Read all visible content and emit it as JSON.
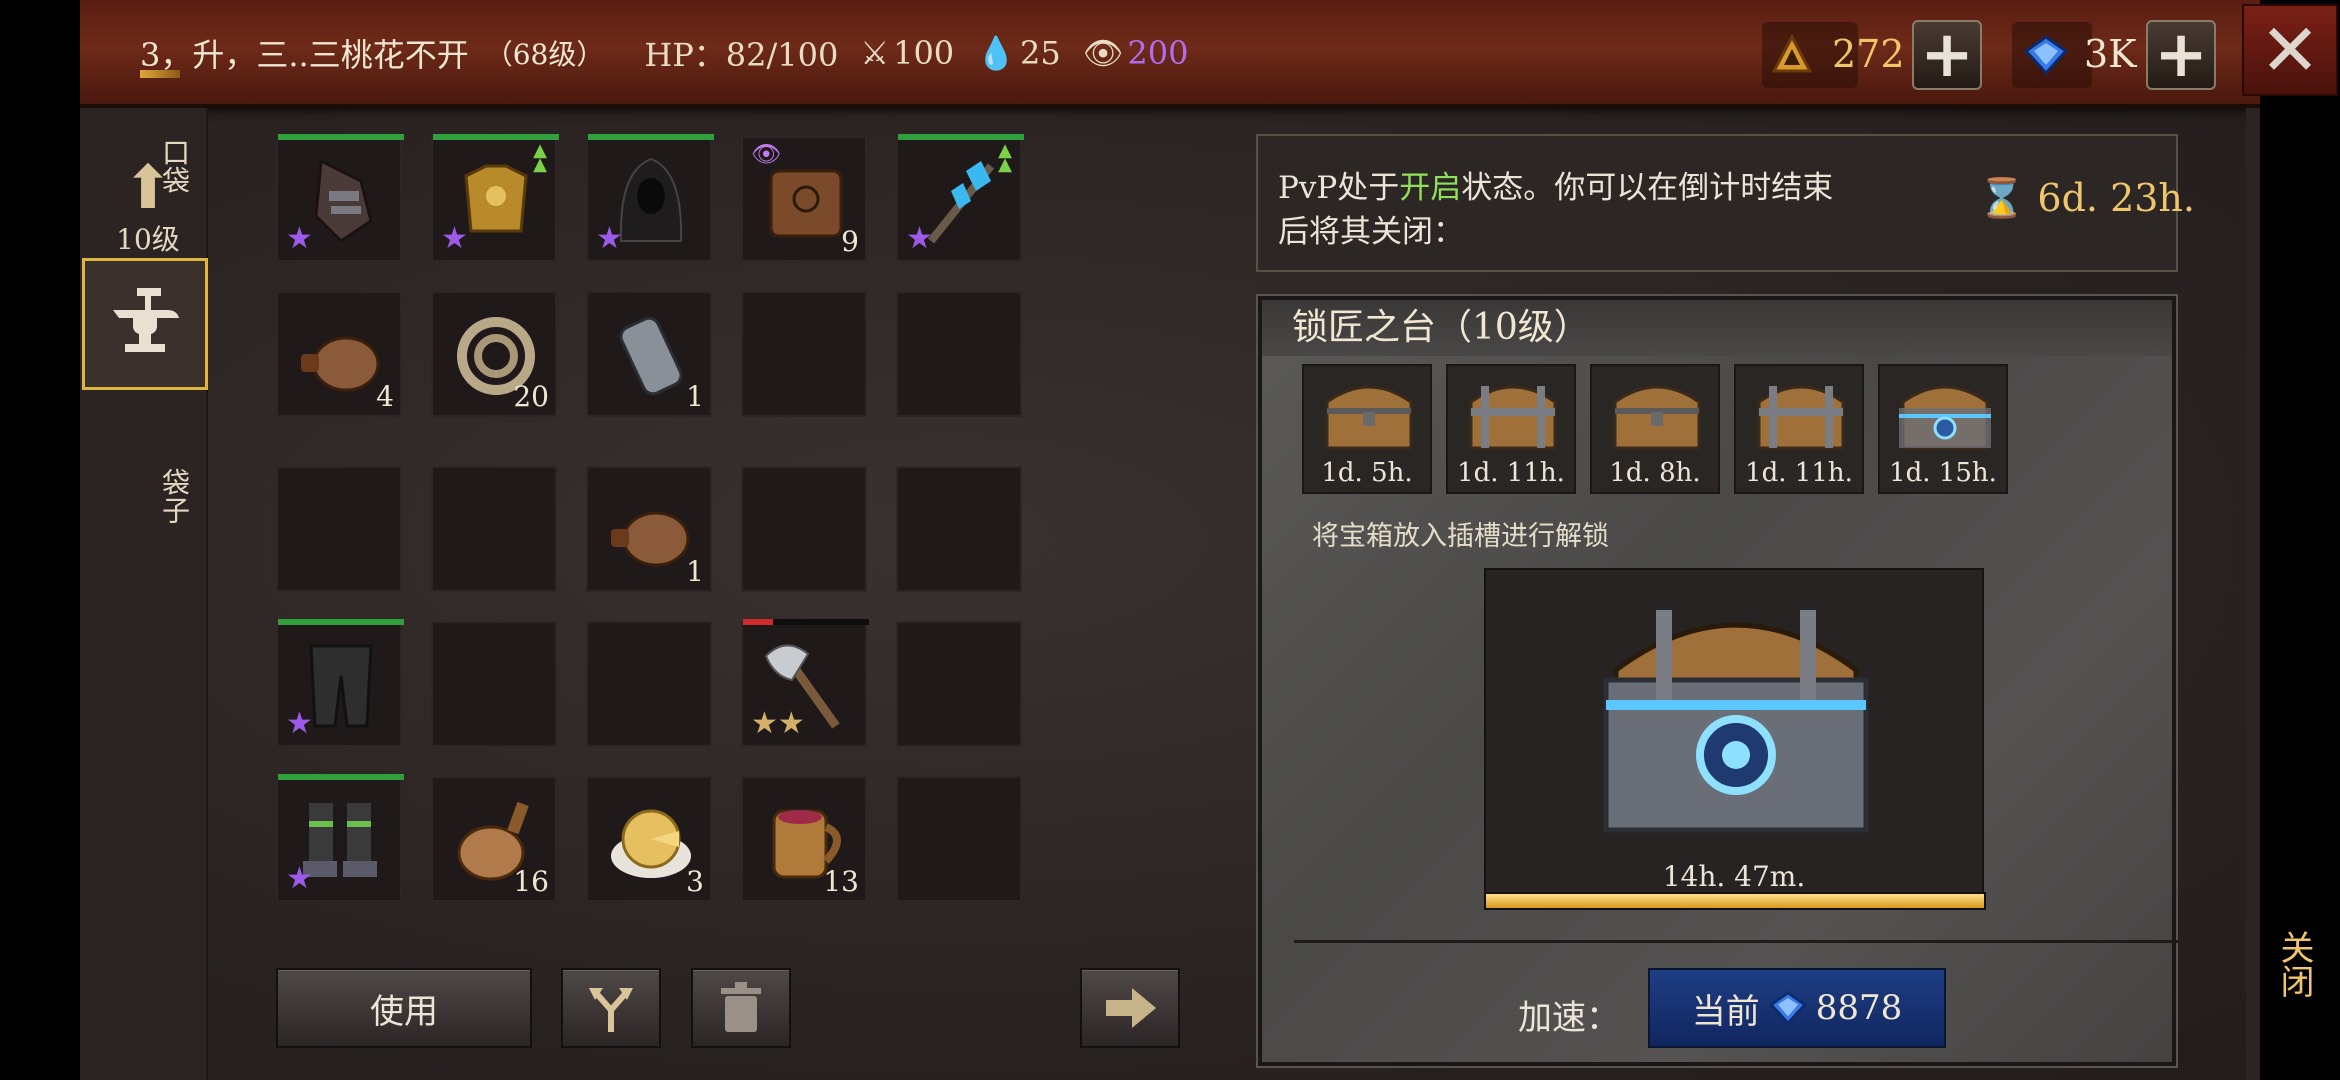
{
  "topbar": {
    "player_name": "3，升，三..三桃花不开",
    "player_level": "（68级）",
    "hp": "HP：82/100",
    "attack": "100",
    "water": "25",
    "vision": "200",
    "resource_amount": "272",
    "gem_amount": "3K",
    "colors": {
      "vision": "#b26cf2",
      "resource": "#f0c66b"
    }
  },
  "leftnav": {
    "upgrade_label": "10级"
  },
  "inventory": {
    "pocket_label": "口袋",
    "bag_label": "袋子",
    "quantities": {
      "r2c1": "4",
      "r2c2": "20",
      "r2c3": "1",
      "r1c4": "9",
      "r3c3": "1",
      "r5c2": "16",
      "r5c3": "3",
      "r5c4": "13"
    }
  },
  "actions": {
    "use_label": "使用"
  },
  "pvp": {
    "text_before": "PvP处于",
    "text_state": "开启",
    "text_after": "状态。你可以在倒计时结束后将其关闭：",
    "timer": "6d. 23h."
  },
  "locksmith": {
    "title": "锁匠之台（10级）",
    "chests": [
      "1d. 5h.",
      "1d. 11h.",
      "1d. 8h.",
      "1d. 11h.",
      "1d. 15h."
    ],
    "hint": "将宝箱放入插槽进行解锁",
    "active_timer": "14h. 47m.",
    "active_progress": 1.0,
    "speed_label": "加速：",
    "speed_button_label": "当前",
    "speed_cost": "8878"
  },
  "close_label": "关闭"
}
